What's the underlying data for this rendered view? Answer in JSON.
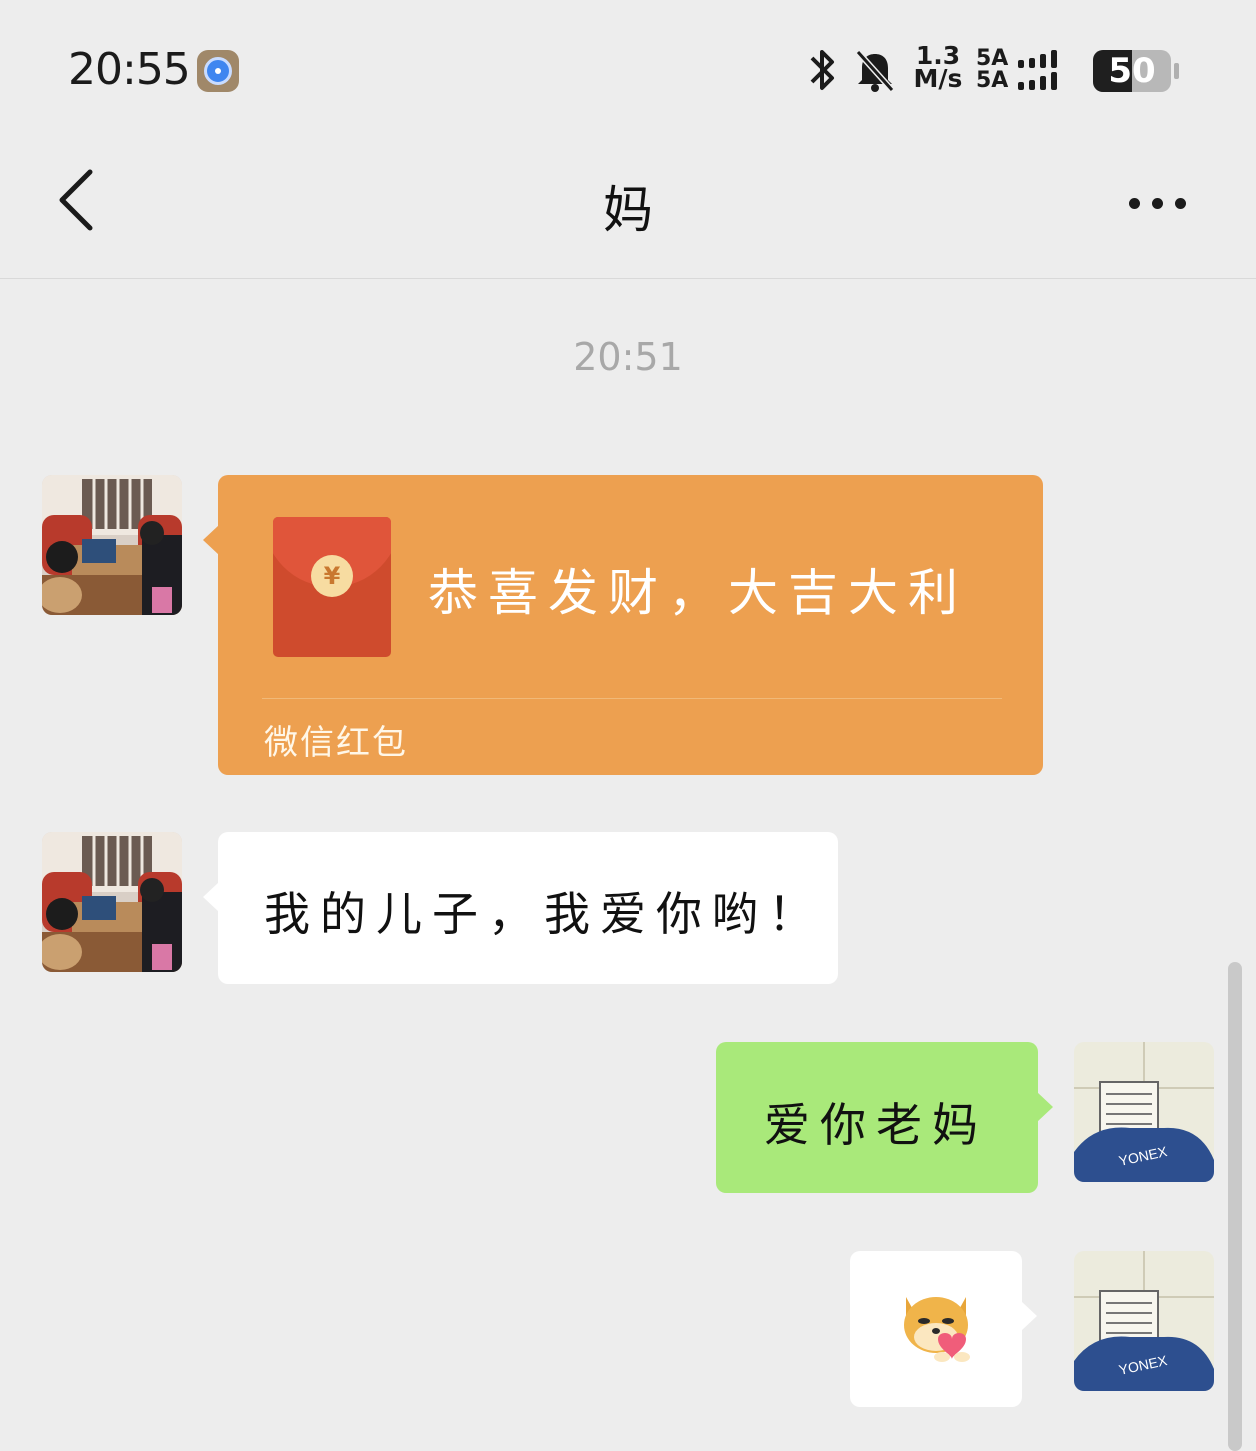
{
  "status_bar": {
    "time": "20:55",
    "net_speed_value": "1.3",
    "net_speed_unit": "M/s",
    "signal_1_label": "5A",
    "signal_2_label": "5A",
    "battery_level": "50",
    "battery_fraction": 0.5
  },
  "header": {
    "title": "妈"
  },
  "chat": {
    "timestamp": "20:51",
    "red_packet": {
      "greeting": "恭喜发财，大吉大利",
      "label": "微信红包",
      "coin_symbol": "¥"
    },
    "mom_message": "我的儿子，我爱你哟！",
    "my_message": "爱你老妈",
    "sticker": "doge-heart-sticker"
  },
  "icons": {
    "app_status": "hotspot-icon",
    "bluetooth": "bluetooth-icon",
    "mute": "bell-muted-icon",
    "back": "chevron-left-icon",
    "more": "more-dots-icon"
  },
  "colors": {
    "background": "#ededed",
    "red_packet": "#eda050",
    "my_bubble": "#a9e97a",
    "their_bubble": "#ffffff"
  }
}
